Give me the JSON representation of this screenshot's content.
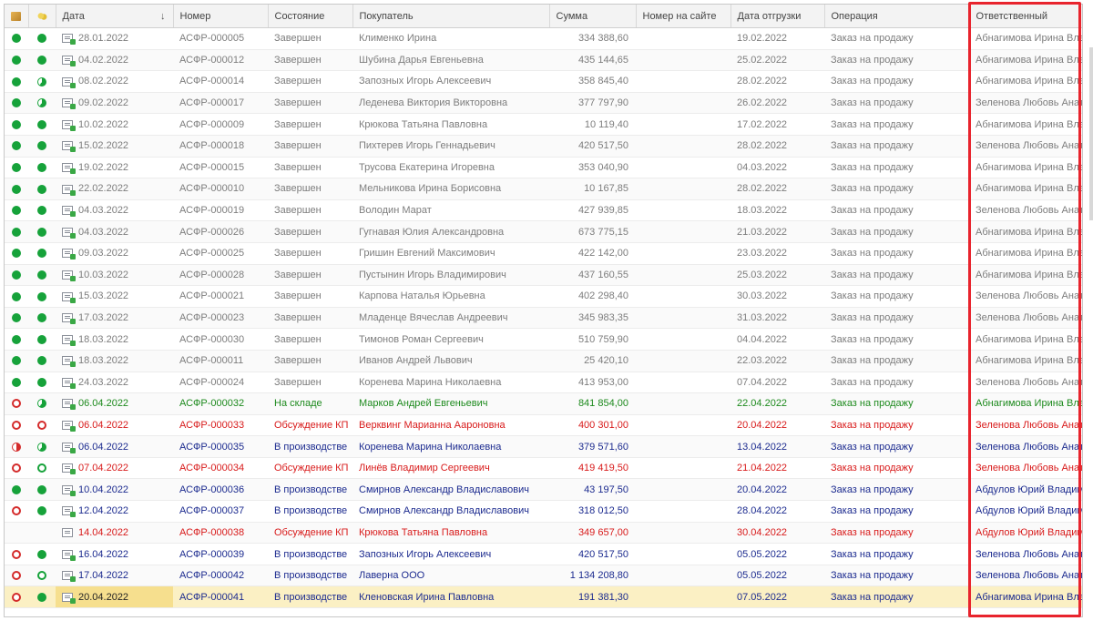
{
  "table": {
    "columns": [
      {
        "key": "icon_status",
        "icon": "box-icon",
        "label": ""
      },
      {
        "key": "icon_payment",
        "icon": "coins-icon",
        "label": ""
      },
      {
        "key": "date",
        "label": "Дата",
        "sort": "↓"
      },
      {
        "key": "number",
        "label": "Номер"
      },
      {
        "key": "state",
        "label": "Состояние"
      },
      {
        "key": "customer",
        "label": "Покупатель"
      },
      {
        "key": "sum",
        "label": "Сумма"
      },
      {
        "key": "site_number",
        "label": "Номер на сайте"
      },
      {
        "key": "ship_date",
        "label": "Дата отгрузки"
      },
      {
        "key": "operation",
        "label": "Операция"
      },
      {
        "key": "responsible",
        "label": "Ответственный"
      }
    ],
    "rows": [
      {
        "c1": "full",
        "c2": "full",
        "doc": "pst",
        "date": "28.01.2022",
        "number": "АСФР-000005",
        "state": "Завершен",
        "customer": "Клименко Ирина",
        "sum": "334 388,60",
        "site": "",
        "ship": "19.02.2022",
        "op": "Заказ на продажу",
        "resp": "Абнагимова Ирина Владимировна",
        "style": "gray"
      },
      {
        "c1": "full",
        "c2": "full",
        "doc": "pst",
        "date": "04.02.2022",
        "number": "АСФР-000012",
        "state": "Завершен",
        "customer": "Шубина Дарья Евгеньевна",
        "sum": "435 144,65",
        "site": "",
        "ship": "25.02.2022",
        "op": "Заказ на продажу",
        "resp": "Абнагимова Ирина Владимировна",
        "style": "gray"
      },
      {
        "c1": "full",
        "c2": "gpart",
        "doc": "pst",
        "date": "08.02.2022",
        "number": "АСФР-000014",
        "state": "Завершен",
        "customer": "Запозных Игорь Алексеевич",
        "sum": "358 845,40",
        "site": "",
        "ship": "28.02.2022",
        "op": "Заказ на продажу",
        "resp": "Абнагимова Ирина Владимировна",
        "style": "gray"
      },
      {
        "c1": "full",
        "c2": "gpart",
        "doc": "pst",
        "date": "09.02.2022",
        "number": "АСФР-000017",
        "state": "Завершен",
        "customer": "Леденева Виктория Викторовна",
        "sum": "377 797,90",
        "site": "",
        "ship": "26.02.2022",
        "op": "Заказ на продажу",
        "resp": "Зеленова Любовь Анатольевна",
        "style": "gray"
      },
      {
        "c1": "full",
        "c2": "full",
        "doc": "pst",
        "date": "10.02.2022",
        "number": "АСФР-000009",
        "state": "Завершен",
        "customer": "Крюкова Татьяна Павловна",
        "sum": "10 119,40",
        "site": "",
        "ship": "17.02.2022",
        "op": "Заказ на продажу",
        "resp": "Абнагимова Ирина Владимировна",
        "style": "gray"
      },
      {
        "c1": "full",
        "c2": "full",
        "doc": "pst",
        "date": "15.02.2022",
        "number": "АСФР-000018",
        "state": "Завершен",
        "customer": "Пихтерев Игорь Геннадьевич",
        "sum": "420 517,50",
        "site": "",
        "ship": "28.02.2022",
        "op": "Заказ на продажу",
        "resp": "Зеленова Любовь Анатольевна",
        "style": "gray"
      },
      {
        "c1": "full",
        "c2": "full",
        "doc": "pst",
        "date": "19.02.2022",
        "number": "АСФР-000015",
        "state": "Завершен",
        "customer": "Трусова Екатерина Игоревна",
        "sum": "353 040,90",
        "site": "",
        "ship": "04.03.2022",
        "op": "Заказ на продажу",
        "resp": "Абнагимова Ирина Владимировна",
        "style": "gray"
      },
      {
        "c1": "full",
        "c2": "full",
        "doc": "pst",
        "date": "22.02.2022",
        "number": "АСФР-000010",
        "state": "Завершен",
        "customer": "Мельникова Ирина Борисовна",
        "sum": "10 167,85",
        "site": "",
        "ship": "28.02.2022",
        "op": "Заказ на продажу",
        "resp": "Абнагимова Ирина Владимировна",
        "style": "gray"
      },
      {
        "c1": "full",
        "c2": "full",
        "doc": "pst",
        "date": "04.03.2022",
        "number": "АСФР-000019",
        "state": "Завершен",
        "customer": "Володин Марат",
        "sum": "427 939,85",
        "site": "",
        "ship": "18.03.2022",
        "op": "Заказ на продажу",
        "resp": "Зеленова Любовь Анатольевна",
        "style": "gray"
      },
      {
        "c1": "full",
        "c2": "full",
        "doc": "pst",
        "date": "04.03.2022",
        "number": "АСФР-000026",
        "state": "Завершен",
        "customer": "Гугнавая Юлия Александровна",
        "sum": "673 775,15",
        "site": "",
        "ship": "21.03.2022",
        "op": "Заказ на продажу",
        "resp": "Абнагимова Ирина Владимировна",
        "style": "gray"
      },
      {
        "c1": "full",
        "c2": "full",
        "doc": "pst",
        "date": "09.03.2022",
        "number": "АСФР-000025",
        "state": "Завершен",
        "customer": "Гришин Евгений Максимович",
        "sum": "422 142,00",
        "site": "",
        "ship": "23.03.2022",
        "op": "Заказ на продажу",
        "resp": "Абнагимова Ирина Владимировна",
        "style": "gray"
      },
      {
        "c1": "full",
        "c2": "full",
        "doc": "pst",
        "date": "10.03.2022",
        "number": "АСФР-000028",
        "state": "Завершен",
        "customer": "Пустынин Игорь Владимирович",
        "sum": "437 160,55",
        "site": "",
        "ship": "25.03.2022",
        "op": "Заказ на продажу",
        "resp": "Абнагимова Ирина Владимировна",
        "style": "gray"
      },
      {
        "c1": "full",
        "c2": "full",
        "doc": "pst",
        "date": "15.03.2022",
        "number": "АСФР-000021",
        "state": "Завершен",
        "customer": "Карпова Наталья Юрьевна",
        "sum": "402 298,40",
        "site": "",
        "ship": "30.03.2022",
        "op": "Заказ на продажу",
        "resp": "Зеленова Любовь Анатольевна",
        "style": "gray"
      },
      {
        "c1": "full",
        "c2": "full",
        "doc": "pst",
        "date": "17.03.2022",
        "number": "АСФР-000023",
        "state": "Завершен",
        "customer": "Младенце Вячеслав Андреевич",
        "sum": "345 983,35",
        "site": "",
        "ship": "31.03.2022",
        "op": "Заказ на продажу",
        "resp": "Зеленова Любовь Анатольевна",
        "style": "gray"
      },
      {
        "c1": "full",
        "c2": "full",
        "doc": "pst",
        "date": "18.03.2022",
        "number": "АСФР-000030",
        "state": "Завершен",
        "customer": "Тимонов Роман Сергеевич",
        "sum": "510 759,90",
        "site": "",
        "ship": "04.04.2022",
        "op": "Заказ на продажу",
        "resp": "Абнагимова Ирина Владимировна",
        "style": "gray"
      },
      {
        "c1": "full",
        "c2": "full",
        "doc": "pst",
        "date": "18.03.2022",
        "number": "АСФР-000011",
        "state": "Завершен",
        "customer": "Иванов Андрей Львович",
        "sum": "25 420,10",
        "site": "",
        "ship": "22.03.2022",
        "op": "Заказ на продажу",
        "resp": "Абнагимова Ирина Владимировна",
        "style": "gray"
      },
      {
        "c1": "full",
        "c2": "full",
        "doc": "pst",
        "date": "24.03.2022",
        "number": "АСФР-000024",
        "state": "Завершен",
        "customer": "Коренева Марина Николаевна",
        "sum": "413 953,00",
        "site": "",
        "ship": "07.04.2022",
        "op": "Заказ на продажу",
        "resp": "Зеленова Любовь Анатольевна",
        "style": "gray"
      },
      {
        "c1": "ring",
        "c2": "gpart",
        "doc": "pst",
        "date": "06.04.2022",
        "number": "АСФР-000032",
        "state": "На складе",
        "customer": "Марков Андрей Евгеньевич",
        "sum": "841 854,00",
        "site": "",
        "ship": "22.04.2022",
        "op": "Заказ на продажу",
        "resp": "Абнагимова Ирина Владимировна",
        "style": "green"
      },
      {
        "c1": "ring",
        "c2": "ring",
        "doc": "pst",
        "date": "06.04.2022",
        "number": "АСФР-000033",
        "state": "Обсуждение КП",
        "customer": "Верквинг Марианна Аароновна",
        "sum": "400 301,00",
        "site": "",
        "ship": "20.04.2022",
        "op": "Заказ на продажу",
        "resp": "Зеленова Любовь Анатольевна",
        "style": "red"
      },
      {
        "c1": "rpart",
        "c2": "gpart",
        "doc": "pst",
        "date": "06.04.2022",
        "number": "АСФР-000035",
        "state": "В производстве",
        "customer": "Коренева Марина Николаевна",
        "sum": "379 571,60",
        "site": "",
        "ship": "13.04.2022",
        "op": "Заказ на продажу",
        "resp": "Зеленова Любовь Анатольевна",
        "style": "blue"
      },
      {
        "c1": "ring",
        "c2": "gring",
        "doc": "pst",
        "date": "07.04.2022",
        "number": "АСФР-000034",
        "state": "Обсуждение КП",
        "customer": "Линёв Владимир Сергеевич",
        "sum": "419 419,50",
        "site": "",
        "ship": "21.04.2022",
        "op": "Заказ на продажу",
        "resp": "Зеленова Любовь Анатольевна",
        "style": "red"
      },
      {
        "c1": "full",
        "c2": "full",
        "doc": "pst",
        "date": "10.04.2022",
        "number": "АСФР-000036",
        "state": "В производстве",
        "customer": "Смирнов Александр Владиславович",
        "sum": "43 197,50",
        "site": "",
        "ship": "20.04.2022",
        "op": "Заказ на продажу",
        "resp": "Абдулов Юрий Владимирович",
        "style": "blue"
      },
      {
        "c1": "ring",
        "c2": "full",
        "doc": "pst",
        "date": "12.04.2022",
        "number": "АСФР-000037",
        "state": "В производстве",
        "customer": "Смирнов Александр Владиславович",
        "sum": "318 012,50",
        "site": "",
        "ship": "28.04.2022",
        "op": "Заказ на продажу",
        "resp": "Абдулов Юрий Владимирович",
        "style": "blue"
      },
      {
        "c1": "none",
        "c2": "none",
        "doc": "plain",
        "date": "14.04.2022",
        "number": "АСФР-000038",
        "state": "Обсуждение КП",
        "customer": "Крюкова Татьяна Павловна",
        "sum": "349 657,00",
        "site": "",
        "ship": "30.04.2022",
        "op": "Заказ на продажу",
        "resp": "Абдулов Юрий Владимирович",
        "style": "red"
      },
      {
        "c1": "ring",
        "c2": "full",
        "doc": "pst",
        "date": "16.04.2022",
        "number": "АСФР-000039",
        "state": "В производстве",
        "customer": "Запозных Игорь Алексеевич",
        "sum": "420 517,50",
        "site": "",
        "ship": "05.05.2022",
        "op": "Заказ на продажу",
        "resp": "Зеленова Любовь Анатольевна",
        "style": "blue"
      },
      {
        "c1": "ring",
        "c2": "gring",
        "doc": "pst",
        "date": "17.04.2022",
        "number": "АСФР-000042",
        "state": "В производстве",
        "customer": "Лаверна ООО",
        "sum": "1 134 208,80",
        "site": "",
        "ship": "05.05.2022",
        "op": "Заказ на продажу",
        "resp": "Зеленова Любовь Анатольевна",
        "style": "blue"
      },
      {
        "c1": "ring",
        "c2": "full",
        "doc": "pst",
        "date": "20.04.2022",
        "number": "АСФР-000041",
        "state": "В производстве",
        "customer": "Кленовская Ирина Павловна",
        "sum": "191 381,30",
        "site": "",
        "ship": "07.05.2022",
        "op": "Заказ на продажу",
        "resp": "Абнагимова Ирина Владимировна",
        "style": "sel"
      }
    ]
  },
  "colors": {
    "highlight": "#e8242d",
    "done": "#16a23a",
    "overdue": "#d42b2b",
    "selected_row": "#fbf0c4"
  }
}
